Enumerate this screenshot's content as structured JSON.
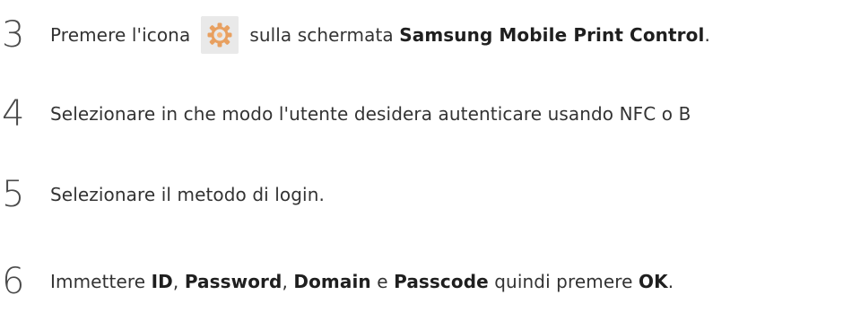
{
  "steps": [
    {
      "number": "3",
      "parts": {
        "a": "Premere l'icona",
        "b": "sulla schermata",
        "c": "Samsung Mobile Print Control",
        "d": "."
      }
    },
    {
      "number": "4",
      "text": "Selezionare in che modo l'utente desidera autenticare usando NFC o B"
    },
    {
      "number": "5",
      "text": "Selezionare il metodo di login."
    },
    {
      "number": "6",
      "parts": {
        "a": "Immettere",
        "b": "ID",
        "c": ",",
        "d": "Password",
        "e": ",",
        "f": "Domain",
        "g": "e",
        "h": "Passcode",
        "i": "quindi premere",
        "j": "OK",
        "k": "."
      }
    }
  ],
  "icons": {
    "settings_icon": "gear-icon",
    "icon_color": "#f0a05a"
  }
}
